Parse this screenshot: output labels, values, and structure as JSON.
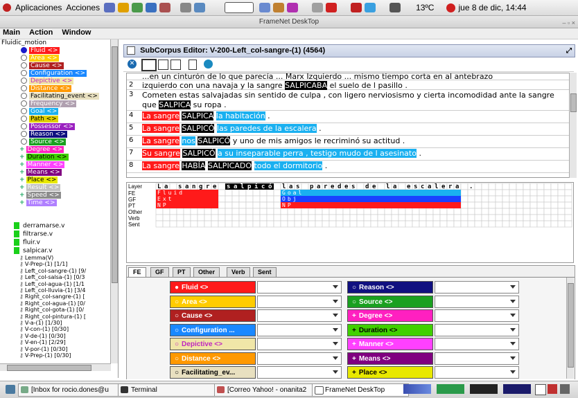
{
  "topbar": {
    "apps": "Aplicaciones",
    "actions": "Acciones",
    "weather": "13ºC",
    "clock": "jue 8 de dic, 14:44"
  },
  "window": {
    "title": "FrameNet DeskTop",
    "menu": [
      "Main",
      "Action",
      "Window"
    ]
  },
  "tree": {
    "root": "Fluidic_motion",
    "fes": [
      {
        "label": "Fluid <>",
        "color": "#ff1a1a",
        "kind": "core",
        "checked": true
      },
      {
        "label": "Area <>",
        "color": "#ffcc00",
        "kind": "core"
      },
      {
        "label": "Cause <>",
        "color": "#b02020",
        "kind": "core"
      },
      {
        "label": "Configuration <>",
        "color": "#1a88ff",
        "kind": "core"
      },
      {
        "label": "Depictive <>",
        "color": "#f0e6a8",
        "kind": "core",
        "text": "#c026c0"
      },
      {
        "label": "Distance <>",
        "color": "#ff9900",
        "kind": "core"
      },
      {
        "label": "Facilitating_event <>",
        "color": "#e8e0c0",
        "kind": "core",
        "text": "#000"
      },
      {
        "label": "Frequency <>",
        "color": "#b0a0b0",
        "kind": "core"
      },
      {
        "label": "Goal <>",
        "color": "#1ab0f0",
        "kind": "core"
      },
      {
        "label": "Path <>",
        "color": "#e0d000",
        "kind": "core",
        "text": "#000"
      },
      {
        "label": "Possessor <>",
        "color": "#9a20c0",
        "kind": "core"
      },
      {
        "label": "Reason <>",
        "color": "#101080",
        "kind": "core"
      },
      {
        "label": "Source <>",
        "color": "#1aa020",
        "kind": "core"
      },
      {
        "label": "Degree <>",
        "color": "#ff20c0",
        "kind": "noncore"
      },
      {
        "label": "Duration <>",
        "color": "#40d000",
        "kind": "noncore",
        "text": "#000"
      },
      {
        "label": "Manner <>",
        "color": "#ff40ff",
        "kind": "noncore"
      },
      {
        "label": "Means <>",
        "color": "#800080",
        "kind": "noncore"
      },
      {
        "label": "Place <>",
        "color": "#e8e800",
        "kind": "noncore",
        "text": "#000"
      },
      {
        "label": "Result <>",
        "color": "#c0c0c0",
        "kind": "noncore"
      },
      {
        "label": "Speed <>",
        "color": "#8c8c8c",
        "kind": "noncore"
      },
      {
        "label": "Time <>",
        "color": "#b080ff",
        "kind": "noncore"
      }
    ],
    "lus": [
      "derramarse.v",
      "filtrarse.v",
      "fluir.v",
      "salpicar.v"
    ],
    "subcorpora": [
      "Lemma(V)",
      "V-Prep-(1) [1/1]",
      "Left_col-sangre-(1) [9/",
      "Left_col-salsa-(1) [0/3",
      "Left_col-agua-(1) [1/1",
      "Left_col-lluvia-(1) [3/4",
      "Right_col-sangre-(1) [",
      "Right_col-agua-(1) [0/",
      "Right_col-gota-(1) [0/",
      "Right_col-pintura-(1) [",
      "V-a-(1) [1/30]",
      "V-con-(1) [0/30]",
      "V-de-(1) [0/30]",
      "V-en-(1) [2/29]",
      "V-por-(1) [0/30]",
      "V-Prep-(1) [0/30]"
    ]
  },
  "editor": {
    "title": "SubCorpus Editor: V-200-Left_col-sangre-(1) (4564)",
    "sentences": [
      {
        "num": "",
        "line1": "...en un cinturón de lo que parecía ... Marx Izquierdo ... mismo tiempo corta en al antebrazo"
      },
      {
        "num": "2",
        "pre": "izquierdo con una navaja y la sangre ",
        "tgt": "SALPICABA",
        "post": " el suelo de l pasillo ."
      },
      {
        "num": "3",
        "pre": "Cometen estas salvajadas sin sentido de culpa , con ligero nerviosismo y cierta incomodidad ante la sangre que ",
        "tgt": "SALPICA",
        "post": " su ropa ."
      },
      {
        "num": "4",
        "fe1": "La sangre",
        "tgt": "SALPICA",
        "fe2": "la habitación",
        "post": " ."
      },
      {
        "num": "5",
        "fe1": "La sangre",
        "tgt": "SALPICÓ",
        "fe2": "las paredes de la escalera",
        "post": " ."
      },
      {
        "num": "6",
        "fe1": "La sangre",
        "mid": "nos",
        "tgt": "SALPICÓ",
        "post": " y uno de mis amigos le recriminó su actitud ."
      },
      {
        "num": "7",
        "fe1": "Su sangre",
        "tgt": "SALPICÓ",
        "fe2": "a su inseparable perra , testigo mudo de l asesinato",
        "post": " ."
      },
      {
        "num": "8",
        "fe1": "La sangre",
        "tgt": "HABÍA",
        "tgt2": "SALPICADO",
        "fe2": "todo el dormitorio",
        "post": " ."
      }
    ],
    "grid": {
      "layers": [
        "Layer",
        "FE",
        "GF",
        "PT",
        "Other",
        "Verb",
        "Sent"
      ],
      "sentence_chars": "La sangre salpicó las paredes de la escalera .",
      "fe_labels": {
        "left": "Fluid",
        "right": "Goal"
      },
      "gf_labels": {
        "left": "Ext",
        "right": "Obj"
      },
      "pt_labels": {
        "left": "NP",
        "right": "NP"
      }
    },
    "tabs": [
      "FE",
      "GF",
      "PT",
      "Other",
      "Verb",
      "Sent"
    ],
    "fe_buttons_left": [
      {
        "label": "Fluid <>",
        "color": "#ff1a1a",
        "mark": "●"
      },
      {
        "label": "Area <>",
        "color": "#ffcc00",
        "mark": "○"
      },
      {
        "label": "Cause <>",
        "color": "#b02020",
        "mark": "○"
      },
      {
        "label": "Configuration ...",
        "color": "#1a88ff",
        "mark": "○"
      },
      {
        "label": "Depictive <>",
        "color": "#f0e6a8",
        "mark": "○",
        "text": "#c026c0"
      },
      {
        "label": "Distance <>",
        "color": "#ff9900",
        "mark": "○"
      },
      {
        "label": "Facilitating_ev...",
        "color": "#e8e0c0",
        "mark": "○",
        "text": "#000"
      }
    ],
    "fe_buttons_right": [
      {
        "label": "Reason <>",
        "color": "#101080",
        "mark": "○"
      },
      {
        "label": "Source <>",
        "color": "#1aa020",
        "mark": "○"
      },
      {
        "label": "Degree <>",
        "color": "#ff20c0",
        "mark": "+"
      },
      {
        "label": "Duration <>",
        "color": "#40d000",
        "mark": "+",
        "text": "#000"
      },
      {
        "label": "Manner <>",
        "color": "#ff40ff",
        "mark": "+"
      },
      {
        "label": "Means <>",
        "color": "#800080",
        "mark": "+"
      },
      {
        "label": "Place <>",
        "color": "#e8e800",
        "mark": "+",
        "text": "#000"
      }
    ]
  },
  "taskbar": [
    "[Inbox for rocio.dones@u",
    "Terminal",
    "[Correo Yahoo! - onanita2",
    "FrameNet DeskTop"
  ]
}
